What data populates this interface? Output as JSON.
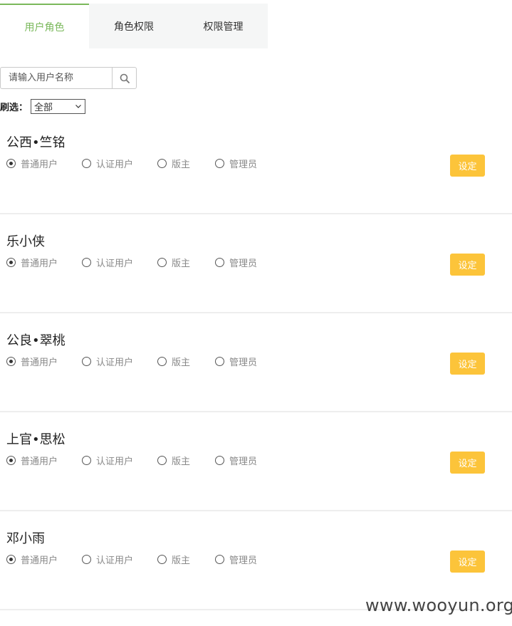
{
  "tabs": [
    {
      "label": "用户角色",
      "active": true
    },
    {
      "label": "角色权限",
      "active": false
    },
    {
      "label": "权限管理",
      "active": false
    }
  ],
  "search": {
    "placeholder": "请输入用户名称",
    "value": "",
    "icon": "search-icon"
  },
  "filter": {
    "label": "刷选：",
    "selected": "全部"
  },
  "role_options": [
    "普通用户",
    "认证用户",
    "版主",
    "管理员"
  ],
  "set_button_label": "设定",
  "users": [
    {
      "name": "公西•竺铭",
      "role": "普通用户"
    },
    {
      "name": "乐小侠",
      "role": "普通用户"
    },
    {
      "name": "公良•翠桃",
      "role": "普通用户"
    },
    {
      "name": "上官•思松",
      "role": "普通用户"
    },
    {
      "name": "邓小雨",
      "role": "普通用户"
    }
  ],
  "colors": {
    "accent": "#7ab85b",
    "button": "#fcc43a",
    "tab_bar": "#f5f6f6"
  },
  "watermark": "www.wooyun.org"
}
